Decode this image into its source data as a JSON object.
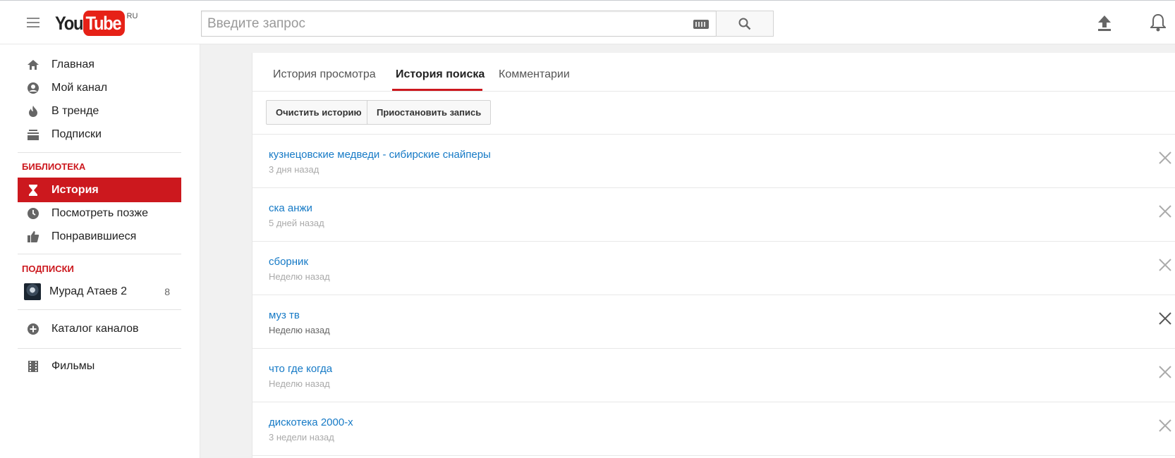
{
  "header": {
    "logo_you": "You",
    "logo_tube": "Tube",
    "logo_region": "RU",
    "search_placeholder": "Введите запрос",
    "icons": [
      "menu-icon",
      "keyboard-icon",
      "search-icon",
      "upload-icon",
      "bell-icon"
    ]
  },
  "sidebar": {
    "main_items": [
      {
        "label": "Главная",
        "icon": "home-icon"
      },
      {
        "label": "Мой канал",
        "icon": "account-icon"
      },
      {
        "label": "В тренде",
        "icon": "flame-icon"
      },
      {
        "label": "Подписки",
        "icon": "subscriptions-icon"
      }
    ],
    "library_title": "БИБЛИОТЕКА",
    "library_items": [
      {
        "label": "История",
        "icon": "hourglass-icon",
        "active": true
      },
      {
        "label": "Посмотреть позже",
        "icon": "clock-icon"
      },
      {
        "label": "Понравившиеся",
        "icon": "thumbs-up-icon"
      }
    ],
    "subscriptions_title": "ПОДПИСКИ",
    "subscriptions": [
      {
        "label": "Мурад Атаев 2",
        "count": "8"
      }
    ],
    "catalog_label": "Каталог каналов",
    "movies_label": "Фильмы"
  },
  "main": {
    "tabs": [
      {
        "label": "История просмотра",
        "active": false
      },
      {
        "label": "История поиска",
        "active": true
      },
      {
        "label": "Комментарии",
        "active": false
      }
    ],
    "clear_button": "Очистить историю",
    "pause_button": "Приостановить запись",
    "history": [
      {
        "query": "кузнецовские медведи - сибирские снайперы",
        "time": "3 дня назад"
      },
      {
        "query": "ска анжи",
        "time": "5 дней назад"
      },
      {
        "query": "сборник",
        "time": "Неделю назад"
      },
      {
        "query": "муз тв",
        "time": "Неделю назад"
      },
      {
        "query": "что где когда",
        "time": "Неделю назад"
      },
      {
        "query": "дискотека 2000-х",
        "time": "3 недели назад"
      }
    ]
  },
  "colors": {
    "brand_red": "#cc181e",
    "link_blue": "#167ac6",
    "background": "#f1f1f1"
  }
}
